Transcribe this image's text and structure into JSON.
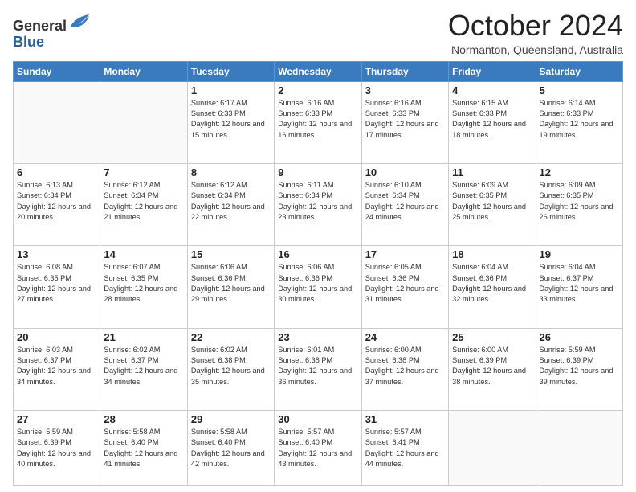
{
  "header": {
    "logo_line1": "General",
    "logo_line2": "Blue",
    "month_title": "October 2024",
    "location": "Normanton, Queensland, Australia"
  },
  "days_of_week": [
    "Sunday",
    "Monday",
    "Tuesday",
    "Wednesday",
    "Thursday",
    "Friday",
    "Saturday"
  ],
  "weeks": [
    [
      {
        "day": "",
        "info": ""
      },
      {
        "day": "",
        "info": ""
      },
      {
        "day": "1",
        "info": "Sunrise: 6:17 AM\nSunset: 6:33 PM\nDaylight: 12 hours and 15 minutes."
      },
      {
        "day": "2",
        "info": "Sunrise: 6:16 AM\nSunset: 6:33 PM\nDaylight: 12 hours and 16 minutes."
      },
      {
        "day": "3",
        "info": "Sunrise: 6:16 AM\nSunset: 6:33 PM\nDaylight: 12 hours and 17 minutes."
      },
      {
        "day": "4",
        "info": "Sunrise: 6:15 AM\nSunset: 6:33 PM\nDaylight: 12 hours and 18 minutes."
      },
      {
        "day": "5",
        "info": "Sunrise: 6:14 AM\nSunset: 6:33 PM\nDaylight: 12 hours and 19 minutes."
      }
    ],
    [
      {
        "day": "6",
        "info": "Sunrise: 6:13 AM\nSunset: 6:34 PM\nDaylight: 12 hours and 20 minutes."
      },
      {
        "day": "7",
        "info": "Sunrise: 6:12 AM\nSunset: 6:34 PM\nDaylight: 12 hours and 21 minutes."
      },
      {
        "day": "8",
        "info": "Sunrise: 6:12 AM\nSunset: 6:34 PM\nDaylight: 12 hours and 22 minutes."
      },
      {
        "day": "9",
        "info": "Sunrise: 6:11 AM\nSunset: 6:34 PM\nDaylight: 12 hours and 23 minutes."
      },
      {
        "day": "10",
        "info": "Sunrise: 6:10 AM\nSunset: 6:34 PM\nDaylight: 12 hours and 24 minutes."
      },
      {
        "day": "11",
        "info": "Sunrise: 6:09 AM\nSunset: 6:35 PM\nDaylight: 12 hours and 25 minutes."
      },
      {
        "day": "12",
        "info": "Sunrise: 6:09 AM\nSunset: 6:35 PM\nDaylight: 12 hours and 26 minutes."
      }
    ],
    [
      {
        "day": "13",
        "info": "Sunrise: 6:08 AM\nSunset: 6:35 PM\nDaylight: 12 hours and 27 minutes."
      },
      {
        "day": "14",
        "info": "Sunrise: 6:07 AM\nSunset: 6:35 PM\nDaylight: 12 hours and 28 minutes."
      },
      {
        "day": "15",
        "info": "Sunrise: 6:06 AM\nSunset: 6:36 PM\nDaylight: 12 hours and 29 minutes."
      },
      {
        "day": "16",
        "info": "Sunrise: 6:06 AM\nSunset: 6:36 PM\nDaylight: 12 hours and 30 minutes."
      },
      {
        "day": "17",
        "info": "Sunrise: 6:05 AM\nSunset: 6:36 PM\nDaylight: 12 hours and 31 minutes."
      },
      {
        "day": "18",
        "info": "Sunrise: 6:04 AM\nSunset: 6:36 PM\nDaylight: 12 hours and 32 minutes."
      },
      {
        "day": "19",
        "info": "Sunrise: 6:04 AM\nSunset: 6:37 PM\nDaylight: 12 hours and 33 minutes."
      }
    ],
    [
      {
        "day": "20",
        "info": "Sunrise: 6:03 AM\nSunset: 6:37 PM\nDaylight: 12 hours and 34 minutes."
      },
      {
        "day": "21",
        "info": "Sunrise: 6:02 AM\nSunset: 6:37 PM\nDaylight: 12 hours and 34 minutes."
      },
      {
        "day": "22",
        "info": "Sunrise: 6:02 AM\nSunset: 6:38 PM\nDaylight: 12 hours and 35 minutes."
      },
      {
        "day": "23",
        "info": "Sunrise: 6:01 AM\nSunset: 6:38 PM\nDaylight: 12 hours and 36 minutes."
      },
      {
        "day": "24",
        "info": "Sunrise: 6:00 AM\nSunset: 6:38 PM\nDaylight: 12 hours and 37 minutes."
      },
      {
        "day": "25",
        "info": "Sunrise: 6:00 AM\nSunset: 6:39 PM\nDaylight: 12 hours and 38 minutes."
      },
      {
        "day": "26",
        "info": "Sunrise: 5:59 AM\nSunset: 6:39 PM\nDaylight: 12 hours and 39 minutes."
      }
    ],
    [
      {
        "day": "27",
        "info": "Sunrise: 5:59 AM\nSunset: 6:39 PM\nDaylight: 12 hours and 40 minutes."
      },
      {
        "day": "28",
        "info": "Sunrise: 5:58 AM\nSunset: 6:40 PM\nDaylight: 12 hours and 41 minutes."
      },
      {
        "day": "29",
        "info": "Sunrise: 5:58 AM\nSunset: 6:40 PM\nDaylight: 12 hours and 42 minutes."
      },
      {
        "day": "30",
        "info": "Sunrise: 5:57 AM\nSunset: 6:40 PM\nDaylight: 12 hours and 43 minutes."
      },
      {
        "day": "31",
        "info": "Sunrise: 5:57 AM\nSunset: 6:41 PM\nDaylight: 12 hours and 44 minutes."
      },
      {
        "day": "",
        "info": ""
      },
      {
        "day": "",
        "info": ""
      }
    ]
  ]
}
